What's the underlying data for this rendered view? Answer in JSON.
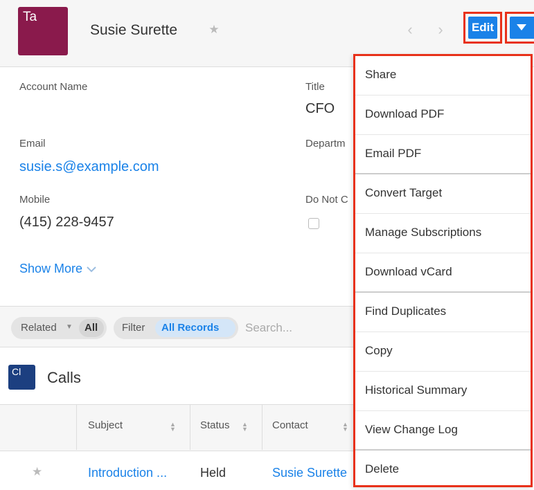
{
  "header": {
    "avatar_text": "Ta",
    "record_name": "Susie Surette",
    "edit_label": "Edit"
  },
  "fields": {
    "account_name_label": "Account Name",
    "title_label": "Title",
    "title_value": "CFO",
    "email_label": "Email",
    "email_value": "susie.s@example.com",
    "department_label": "Departm",
    "mobile_label": "Mobile",
    "mobile_value": "(415) 228-9457",
    "do_not_call_label": "Do Not C",
    "show_more": "Show More"
  },
  "filter": {
    "related_label": "Related",
    "all_label": "All",
    "filter_label": "Filter",
    "all_records_label": "All Records",
    "search_placeholder": "Search..."
  },
  "calls": {
    "badge": "Cl",
    "title": "Calls",
    "columns": [
      "Subject",
      "Status",
      "Contact"
    ],
    "rows": [
      {
        "subject": "Introduction ...",
        "status": "Held",
        "contact": "Susie Surette"
      }
    ]
  },
  "menu": {
    "items": [
      "Share",
      "Download PDF",
      "Email PDF",
      "Convert Target",
      "Manage Subscriptions",
      "Download vCard",
      "Find Duplicates",
      "Copy",
      "Historical Summary",
      "View Change Log",
      "Delete"
    ]
  },
  "colors": {
    "accent": "#1a82e8",
    "highlight": "#e8311a",
    "avatar": "#8a1a4c",
    "calls_badge": "#1c3f80"
  }
}
